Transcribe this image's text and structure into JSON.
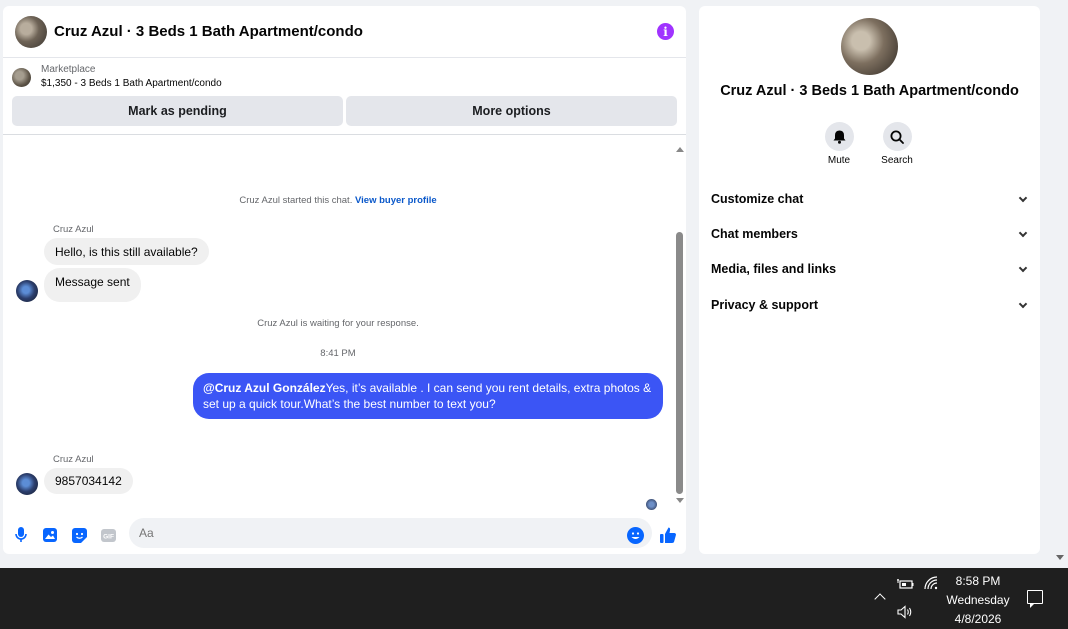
{
  "chat": {
    "title": "Cruz Azul · 3 Beds 1 Bath Apartment/condo",
    "listing": {
      "category": "Marketplace",
      "description": "$1,350 - 3 Beds 1 Bath Apartment/condo"
    },
    "actions": {
      "mark_pending": "Mark as pending",
      "more_options": "More options"
    },
    "system": {
      "started": "Cruz Azul started this chat.",
      "view_profile": "View buyer profile",
      "waiting": "Cruz Azul is waiting for your response.",
      "timestamp": "8:41 PM"
    },
    "messages": {
      "sender_name": "Cruz Azul",
      "msg1": "Hello, is this still available?",
      "msg2": "Message sent",
      "out_mention": "@Cruz Azul González",
      "out_text": "Yes, it’s available .  I can send you rent details, extra photos & set up a quick tour.What’s the best number to text you?",
      "sender_name_2": "Cruz Azul",
      "msg3": "9857034142"
    },
    "composer": {
      "placeholder": "Aa"
    }
  },
  "info_panel": {
    "title": "Cruz Azul · 3 Beds 1 Bath Apartment/condo",
    "quick_actions": {
      "mute": "Mute",
      "search": "Search"
    },
    "sections": {
      "customize": "Customize chat",
      "members": "Chat members",
      "media": "Media, files and links",
      "privacy": "Privacy & support"
    }
  },
  "taskbar": {
    "time": "8:58 PM",
    "day": "Wednesday",
    "date": "4/8/2026"
  },
  "colors": {
    "accent": "#0866ff",
    "outgoing_bubble": "#3b55f5",
    "info_icon": "#a033ff"
  }
}
